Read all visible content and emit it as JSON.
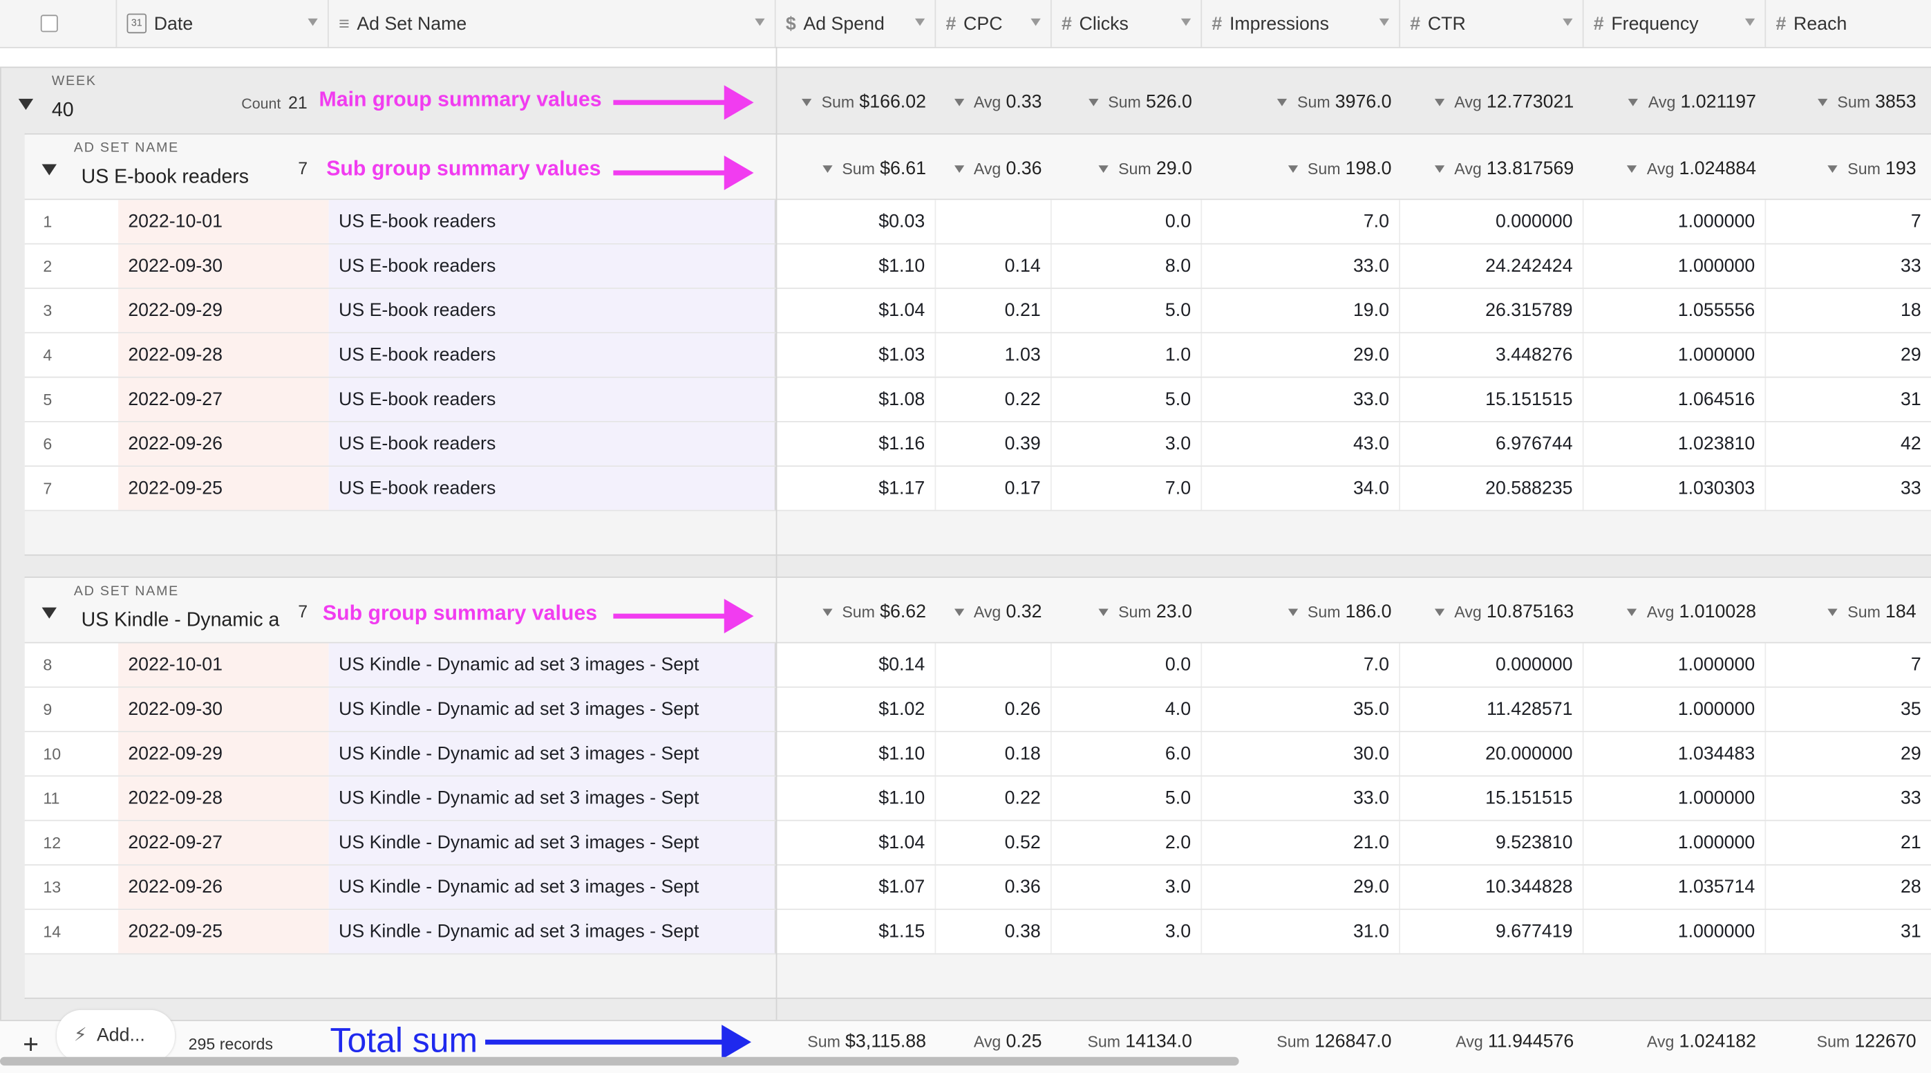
{
  "columns": [
    {
      "label": "Date",
      "icon": "calendar-icon",
      "cal_text": "31"
    },
    {
      "label": "Ad Set Name",
      "icon": "text-icon"
    },
    {
      "label": "Ad Spend",
      "icon": "currency-icon"
    },
    {
      "label": "CPC",
      "icon": "number-icon"
    },
    {
      "label": "Clicks",
      "icon": "number-icon"
    },
    {
      "label": "Impressions",
      "icon": "number-icon"
    },
    {
      "label": "CTR",
      "icon": "number-icon"
    },
    {
      "label": "Frequency",
      "icon": "number-icon"
    },
    {
      "label": "Reach",
      "icon": "number-icon"
    }
  ],
  "main_group": {
    "label": "WEEK",
    "value": "40",
    "count_label": "Count",
    "count": "21",
    "annotation": "Main group summary values",
    "summary": [
      {
        "kind": "Sum",
        "value": "$166.02"
      },
      {
        "kind": "Avg",
        "value": "0.33"
      },
      {
        "kind": "Sum",
        "value": "526.0"
      },
      {
        "kind": "Sum",
        "value": "3976.0"
      },
      {
        "kind": "Avg",
        "value": "12.773021"
      },
      {
        "kind": "Avg",
        "value": "1.021197"
      },
      {
        "kind": "Sum",
        "value": "3853"
      }
    ]
  },
  "sub_groups": [
    {
      "label": "AD SET NAME",
      "title": "US E-book readers",
      "count": "7",
      "annotation": "Sub group summary values",
      "summary": [
        {
          "kind": "Sum",
          "value": "$6.61"
        },
        {
          "kind": "Avg",
          "value": "0.36"
        },
        {
          "kind": "Sum",
          "value": "29.0"
        },
        {
          "kind": "Sum",
          "value": "198.0"
        },
        {
          "kind": "Avg",
          "value": "13.817569"
        },
        {
          "kind": "Avg",
          "value": "1.024884"
        },
        {
          "kind": "Sum",
          "value": "193"
        }
      ],
      "rows": [
        [
          "1",
          "2022-10-01",
          "US E-book readers",
          "$0.03",
          "",
          "0.0",
          "7.0",
          "0.000000",
          "1.000000",
          "7"
        ],
        [
          "2",
          "2022-09-30",
          "US E-book readers",
          "$1.10",
          "0.14",
          "8.0",
          "33.0",
          "24.242424",
          "1.000000",
          "33"
        ],
        [
          "3",
          "2022-09-29",
          "US E-book readers",
          "$1.04",
          "0.21",
          "5.0",
          "19.0",
          "26.315789",
          "1.055556",
          "18"
        ],
        [
          "4",
          "2022-09-28",
          "US E-book readers",
          "$1.03",
          "1.03",
          "1.0",
          "29.0",
          "3.448276",
          "1.000000",
          "29"
        ],
        [
          "5",
          "2022-09-27",
          "US E-book readers",
          "$1.08",
          "0.22",
          "5.0",
          "33.0",
          "15.151515",
          "1.064516",
          "31"
        ],
        [
          "6",
          "2022-09-26",
          "US E-book readers",
          "$1.16",
          "0.39",
          "3.0",
          "43.0",
          "6.976744",
          "1.023810",
          "42"
        ],
        [
          "7",
          "2022-09-25",
          "US E-book readers",
          "$1.17",
          "0.17",
          "7.0",
          "34.0",
          "20.588235",
          "1.030303",
          "33"
        ]
      ]
    },
    {
      "label": "AD SET NAME",
      "title": "US Kindle - Dynamic a",
      "count": "7",
      "annotation": "Sub group summary values",
      "summary": [
        {
          "kind": "Sum",
          "value": "$6.62"
        },
        {
          "kind": "Avg",
          "value": "0.32"
        },
        {
          "kind": "Sum",
          "value": "23.0"
        },
        {
          "kind": "Sum",
          "value": "186.0"
        },
        {
          "kind": "Avg",
          "value": "10.875163"
        },
        {
          "kind": "Avg",
          "value": "1.010028"
        },
        {
          "kind": "Sum",
          "value": "184"
        }
      ],
      "rows": [
        [
          "8",
          "2022-10-01",
          "US Kindle - Dynamic ad set 3 images - Sept",
          "$0.14",
          "",
          "0.0",
          "7.0",
          "0.000000",
          "1.000000",
          "7"
        ],
        [
          "9",
          "2022-09-30",
          "US Kindle - Dynamic ad set 3 images - Sept",
          "$1.02",
          "0.26",
          "4.0",
          "35.0",
          "11.428571",
          "1.000000",
          "35"
        ],
        [
          "10",
          "2022-09-29",
          "US Kindle - Dynamic ad set 3 images - Sept",
          "$1.10",
          "0.18",
          "6.0",
          "30.0",
          "20.000000",
          "1.034483",
          "29"
        ],
        [
          "11",
          "2022-09-28",
          "US Kindle - Dynamic ad set 3 images - Sept",
          "$1.10",
          "0.22",
          "5.0",
          "33.0",
          "15.151515",
          "1.000000",
          "33"
        ],
        [
          "12",
          "2022-09-27",
          "US Kindle - Dynamic ad set 3 images - Sept",
          "$1.04",
          "0.52",
          "2.0",
          "21.0",
          "9.523810",
          "1.000000",
          "21"
        ],
        [
          "13",
          "2022-09-26",
          "US Kindle - Dynamic ad set 3 images - Sept",
          "$1.07",
          "0.36",
          "3.0",
          "29.0",
          "10.344828",
          "1.035714",
          "28"
        ],
        [
          "14",
          "2022-09-25",
          "US Kindle - Dynamic ad set 3 images - Sept",
          "$1.15",
          "0.38",
          "3.0",
          "31.0",
          "9.677419",
          "1.000000",
          "31"
        ]
      ]
    }
  ],
  "footer": {
    "add_symbol": "+",
    "add_label": "Add...",
    "records": "295 records",
    "total_annotation": "Total sum",
    "totals": [
      {
        "kind": "Sum",
        "value": "$3,115.88"
      },
      {
        "kind": "Avg",
        "value": "0.25"
      },
      {
        "kind": "Sum",
        "value": "14134.0"
      },
      {
        "kind": "Sum",
        "value": "126847.0"
      },
      {
        "kind": "Avg",
        "value": "11.944576"
      },
      {
        "kind": "Avg",
        "value": "1.024182"
      },
      {
        "kind": "Sum",
        "value": "122670"
      }
    ]
  },
  "colors": {
    "annotation_magenta": "#f13cf0",
    "annotation_blue": "#1f29ee",
    "date_cell_bg": "#fdf1ee",
    "name_cell_bg": "#f3f1fc"
  }
}
